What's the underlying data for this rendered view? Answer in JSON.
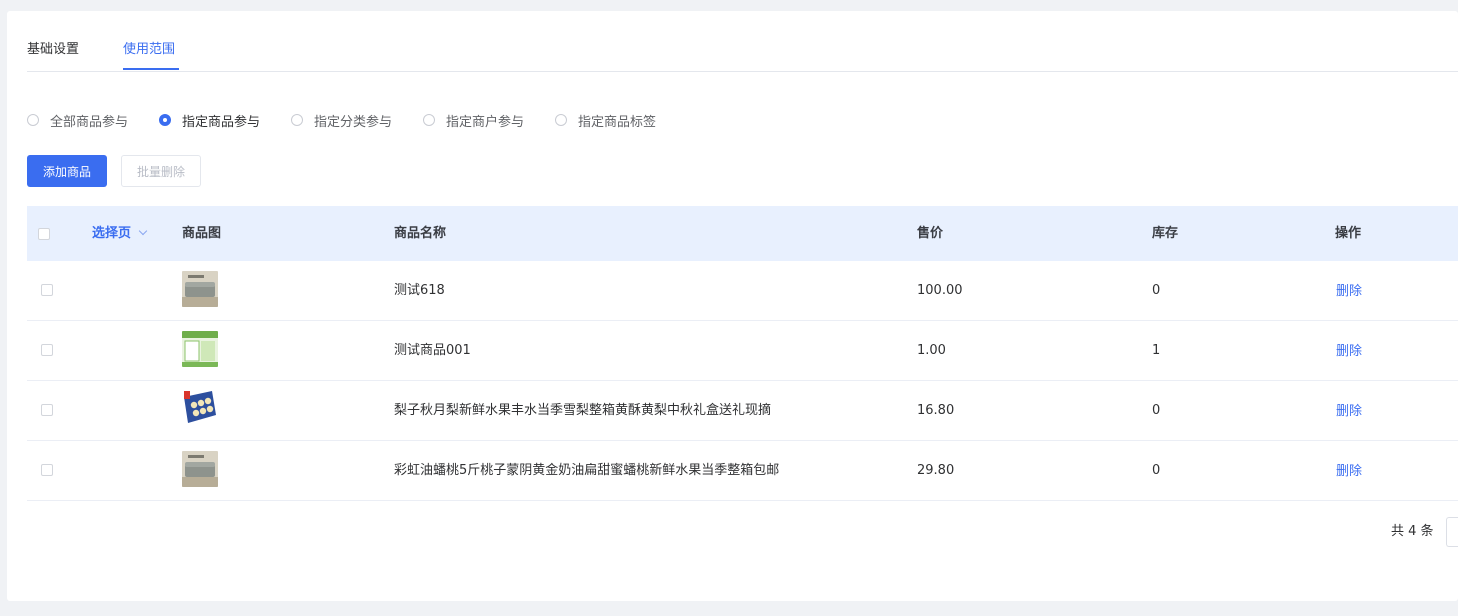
{
  "tabs": [
    {
      "label": "基础设置",
      "active": false
    },
    {
      "label": "使用范围",
      "active": true
    }
  ],
  "scope_options": [
    {
      "label": "全部商品参与",
      "checked": false
    },
    {
      "label": "指定商品参与",
      "checked": true
    },
    {
      "label": "指定分类参与",
      "checked": false
    },
    {
      "label": "指定商户参与",
      "checked": false
    },
    {
      "label": "指定商品标签",
      "checked": false
    }
  ],
  "actions": {
    "add_label": "添加商品",
    "batch_delete_label": "批量删除"
  },
  "table": {
    "select_page": "选择页",
    "columns": {
      "image": "商品图",
      "name": "商品名称",
      "price": "售价",
      "stock": "库存",
      "action": "操作"
    },
    "rows": [
      {
        "name": "测试618",
        "price": "100.00",
        "stock": "0",
        "action": "删除",
        "thumb": "sofa"
      },
      {
        "name": "测试商品001",
        "price": "1.00",
        "stock": "1",
        "action": "删除",
        "thumb": "green-box"
      },
      {
        "name": "梨子秋月梨新鲜水果丰水当季雪梨整箱黄酥黄梨中秋礼盒送礼现摘",
        "price": "16.80",
        "stock": "0",
        "action": "删除",
        "thumb": "pear-giftbox"
      },
      {
        "name": "彩虹油蟠桃5斤桃子蒙阴黄金奶油扁甜蜜蟠桃新鲜水果当季整箱包邮",
        "price": "29.80",
        "stock": "0",
        "action": "删除",
        "thumb": "sofa"
      }
    ]
  },
  "pagination": {
    "total_text": "共 4 条"
  },
  "colors": {
    "accent": "#3a6df0",
    "header_bg": "#e8f0fe",
    "page_bg": "#f0f2f5"
  }
}
